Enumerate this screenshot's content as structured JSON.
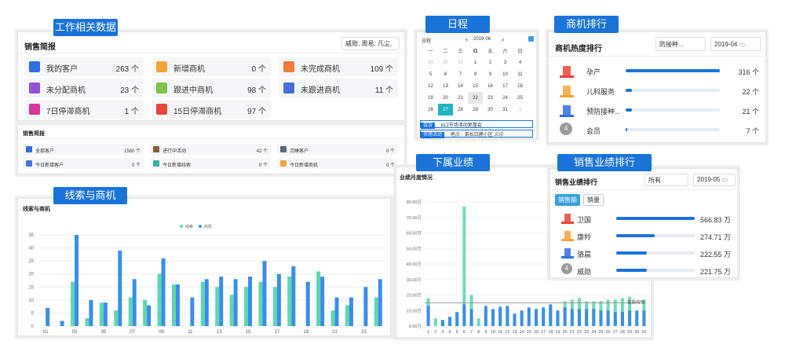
{
  "tags": {
    "work": "工作相关数据",
    "schedule": "日程",
    "rank": "商机排行",
    "clues": "线索与商机",
    "sub": "下属业绩",
    "perf": "销售业绩排行"
  },
  "sales": {
    "title": "销售简报",
    "users": "威勋, 周易, 凡尘,",
    "items": [
      {
        "label": "我的客户",
        "value": "263 个",
        "color": "#2f6fe0",
        "icon": "user-icon"
      },
      {
        "label": "新增商机",
        "value": "0 个",
        "color": "#f2a33a",
        "icon": "lightbulb-icon"
      },
      {
        "label": "未完成商机",
        "value": "109 个",
        "color": "#f07a3a",
        "icon": "bulb-icon"
      },
      {
        "label": "未分配商机",
        "value": "23 个",
        "color": "#8f54d8",
        "icon": "tag-icon"
      },
      {
        "label": "跟进中商机",
        "value": "98 个",
        "color": "#7ec24d",
        "icon": "footprint-icon"
      },
      {
        "label": "未跟进商机",
        "value": "11 个",
        "color": "#4a6fd8",
        "icon": "block-icon"
      },
      {
        "label": "7日停滞商机",
        "value": "1 个",
        "color": "#d8369a",
        "icon": "calendar-icon"
      },
      {
        "label": "15日停滞商机",
        "value": "97 个",
        "color": "#e8453a",
        "icon": "calendar-icon"
      }
    ]
  },
  "mini": {
    "title": "销售简报",
    "items": [
      {
        "label": "全部客户",
        "value": "1560 个",
        "color": "#2f6fe0"
      },
      {
        "label": "进行中活动",
        "value": "42 个",
        "color": "#8a5a3a"
      },
      {
        "label": "沉睡客户",
        "value": "0 个",
        "color": "#5a6a7a"
      },
      {
        "label": "今日新增客户",
        "value": "0 个",
        "color": "#4a6fd8"
      },
      {
        "label": "今日新增线索",
        "value": "0 个",
        "color": "#3ab0a0"
      },
      {
        "label": "今日新增商机",
        "value": "0 个",
        "color": "#f2a33a"
      }
    ]
  },
  "calendar": {
    "label": "日程",
    "month": "2019-06",
    "prev": "‹",
    "next": "›",
    "weekdays": [
      "一",
      "二",
      "三",
      "四",
      "五",
      "六",
      "日"
    ],
    "rows": [
      [
        "29",
        "30",
        "31",
        "1",
        "2",
        "3",
        "4"
      ],
      [
        "5",
        "6",
        "7",
        "8",
        "9",
        "10",
        "11"
      ],
      [
        "12",
        "13",
        "14",
        "15",
        "16",
        "17",
        "18"
      ],
      [
        "19",
        "20",
        "21",
        "22",
        "23",
        "24",
        "25"
      ],
      [
        "26",
        "27",
        "28",
        "29",
        "30",
        "31",
        "1"
      ]
    ],
    "events": [
      {
        "type": "会议",
        "text": "812市场活动复盘会"
      },
      {
        "type": "市场活动",
        "text": "地点：莱松白鹿小区 义诊"
      }
    ]
  },
  "rank": {
    "title": "商机热度排行",
    "filter": "防接种...",
    "month": "2019-04",
    "items": [
      {
        "name": "孕产",
        "value": "316 个",
        "pct": 1.0
      },
      {
        "name": "儿科服务",
        "value": "22 个",
        "pct": 0.07
      },
      {
        "name": "预防接种...",
        "value": "21 个",
        "pct": 0.066
      },
      {
        "name": "会员",
        "value": "7 个",
        "pct": 0.02
      }
    ],
    "badge4": "4"
  },
  "clues": {
    "title": "线索与商机",
    "legend": [
      "线索",
      "商机"
    ],
    "series_colors": [
      "#5ed6b4",
      "#3a8ee8"
    ]
  },
  "sub": {
    "title": "业绩月度情况",
    "avg_label": "实际均线"
  },
  "perf": {
    "title": "销售业绩排行",
    "filter": "所有",
    "month": "2019-05",
    "tabs": [
      "销售额",
      "销量"
    ],
    "items": [
      {
        "name": "卫国",
        "value": "566.83 万",
        "pct": 1.0
      },
      {
        "name": "康羚",
        "value": "274.71 万",
        "pct": 0.485
      },
      {
        "name": "骆晨",
        "value": "222.55 万",
        "pct": 0.393
      },
      {
        "name": "威勋",
        "value": "221.75 万",
        "pct": 0.391
      }
    ],
    "badge4": "4"
  },
  "chart_data": [
    {
      "type": "bar",
      "title": "线索与商机",
      "categories": [
        "01",
        "02",
        "03",
        "04",
        "05",
        "06",
        "07",
        "08",
        "09",
        "10",
        "11",
        "12",
        "13",
        "14",
        "15",
        "16",
        "17",
        "18",
        "19",
        "20",
        "21",
        "22",
        "23",
        "24"
      ],
      "ylim": [
        0,
        35
      ],
      "yticks": [
        0,
        5,
        10,
        15,
        20,
        25,
        30,
        35
      ],
      "series": [
        {
          "name": "线索",
          "values": [
            0,
            0,
            17,
            3,
            9,
            6,
            11,
            10,
            20,
            16,
            0,
            17,
            15,
            12,
            15,
            17,
            15,
            19,
            0,
            21,
            6,
            8,
            0,
            11
          ]
        },
        {
          "name": "商机",
          "values": [
            7,
            2,
            35,
            10,
            9,
            29,
            18,
            8,
            26,
            16,
            11,
            18,
            19,
            18,
            19,
            25,
            20,
            23,
            17,
            19,
            11,
            11,
            15,
            18
          ]
        }
      ]
    },
    {
      "type": "bar",
      "title": "业绩月度情况",
      "categories": [
        "1",
        "2",
        "3",
        "4",
        "5",
        "6",
        "7",
        "8",
        "9",
        "10",
        "11",
        "12",
        "13",
        "14",
        "15",
        "16",
        "17",
        "18",
        "19",
        "20",
        "21",
        "22",
        "23",
        "24",
        "25",
        "26",
        "27",
        "28",
        "29",
        "30",
        "31"
      ],
      "ylim": [
        0,
        80
      ],
      "yticks": [
        "0.00万",
        "10.00万",
        "20.00万",
        "30.00万",
        "40.00万",
        "50.00万",
        "60.00万",
        "70.00万",
        "80.00万"
      ],
      "series": [
        {
          "name": "",
          "values": [
            18,
            5,
            1,
            3,
            7,
            77,
            20,
            5,
            0,
            0,
            13,
            9,
            8,
            0,
            0,
            0,
            7,
            14,
            9,
            16,
            17,
            18,
            16,
            16,
            16,
            17,
            17,
            18,
            19,
            6,
            17
          ],
          "color": "#5ed6b4"
        },
        {
          "name": "",
          "values": [
            13,
            0,
            4,
            6,
            9,
            14,
            11,
            0,
            13,
            11,
            12,
            13,
            8,
            10,
            12,
            11,
            12,
            14,
            10,
            12,
            11,
            11,
            11,
            11,
            10,
            10,
            9,
            9,
            10,
            10,
            10
          ],
          "color": "#3a8ee8"
        }
      ],
      "avg": 15
    }
  ]
}
